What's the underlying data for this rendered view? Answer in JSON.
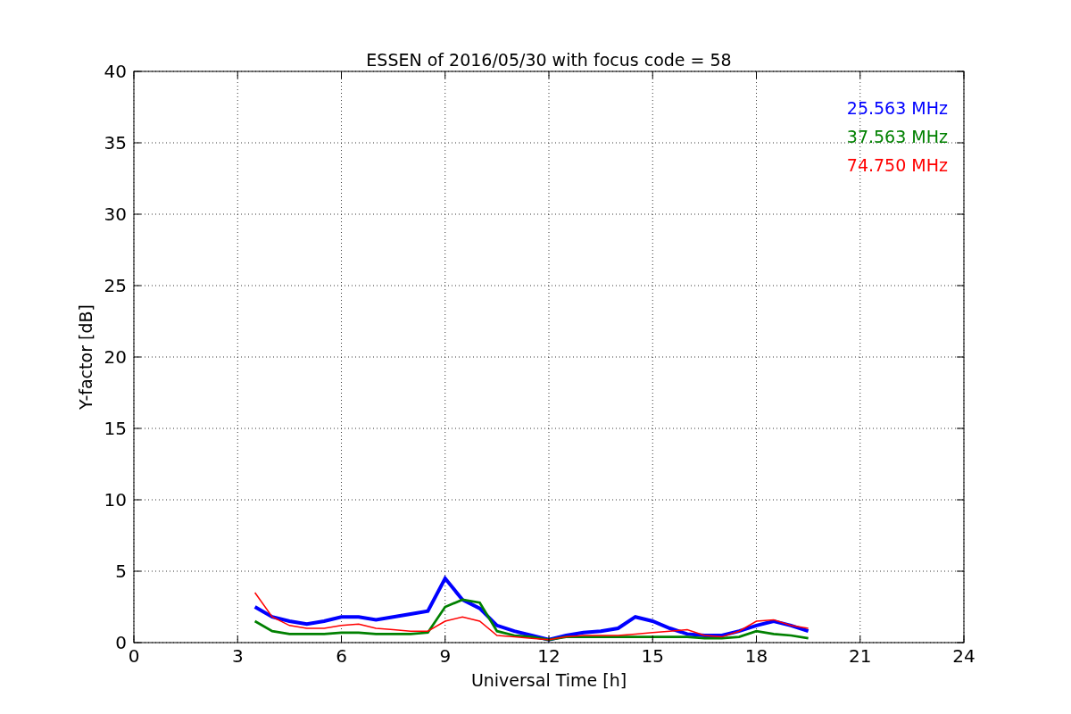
{
  "chart_data": {
    "type": "line",
    "title": "ESSEN of 2016/05/30 with focus code = 58",
    "xlabel": "Universal Time [h]",
    "ylabel": "Y-factor [dB]",
    "x": [
      3.5,
      4,
      4.5,
      5,
      5.5,
      6,
      6.5,
      7,
      7.5,
      8,
      8.5,
      9,
      9.5,
      10,
      10.5,
      11,
      11.5,
      12,
      12.5,
      13,
      13.5,
      14,
      14.5,
      15,
      15.5,
      16,
      16.5,
      17,
      17.5,
      18,
      18.5,
      19,
      19.5
    ],
    "series": [
      {
        "name": "25.563 MHz",
        "color": "#0000ff",
        "values": [
          2.5,
          1.8,
          1.5,
          1.3,
          1.5,
          1.8,
          1.8,
          1.6,
          1.8,
          2.0,
          2.2,
          4.5,
          3.0,
          2.4,
          1.2,
          0.8,
          0.5,
          0.2,
          0.5,
          0.7,
          0.8,
          1.0,
          1.8,
          1.5,
          1.0,
          0.6,
          0.5,
          0.5,
          0.8,
          1.2,
          1.5,
          1.2,
          0.8
        ]
      },
      {
        "name": "37.563 MHz",
        "color": "#008000",
        "values": [
          1.5,
          0.8,
          0.6,
          0.6,
          0.6,
          0.7,
          0.7,
          0.6,
          0.6,
          0.6,
          0.7,
          2.5,
          3.0,
          2.8,
          0.8,
          0.5,
          0.4,
          0.2,
          0.4,
          0.4,
          0.4,
          0.4,
          0.4,
          0.4,
          0.4,
          0.4,
          0.3,
          0.3,
          0.4,
          0.8,
          0.6,
          0.5,
          0.3
        ]
      },
      {
        "name": "74.750 MHz",
        "color": "#ff0000",
        "values": [
          3.5,
          1.8,
          1.2,
          1.0,
          1.0,
          1.2,
          1.3,
          1.0,
          0.9,
          0.8,
          0.8,
          1.5,
          1.8,
          1.5,
          0.5,
          0.4,
          0.3,
          0.2,
          0.4,
          0.5,
          0.5,
          0.5,
          0.6,
          0.7,
          0.8,
          0.9,
          0.5,
          0.4,
          0.8,
          1.5,
          1.6,
          1.2,
          1.0
        ]
      }
    ],
    "grid": true,
    "xlim": [
      0,
      24
    ],
    "ylim": [
      0,
      40
    ],
    "xticks": [
      0,
      3,
      6,
      9,
      12,
      15,
      18,
      21,
      24
    ],
    "yticks": [
      0,
      5,
      10,
      15,
      20,
      25,
      30,
      35,
      40
    ]
  }
}
